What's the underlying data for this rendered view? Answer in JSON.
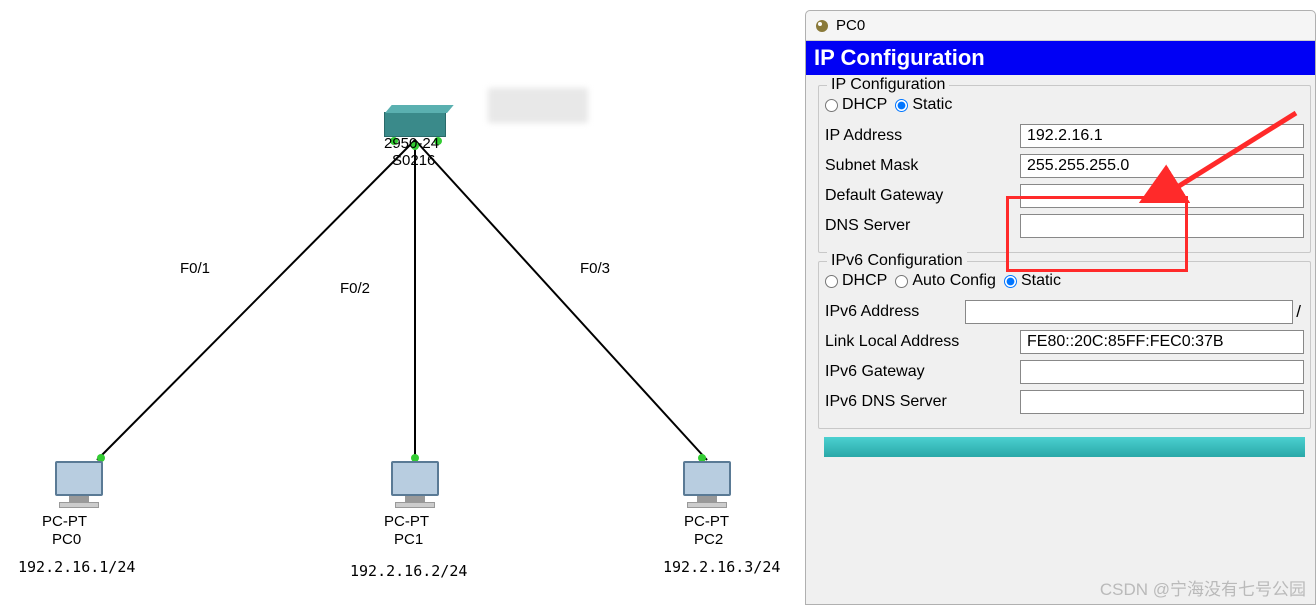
{
  "topology": {
    "switch": {
      "model": "2950-24",
      "name": "S0216"
    },
    "ports": {
      "p1": "F0/1",
      "p2": "F0/2",
      "p3": "F0/3"
    },
    "pc0": {
      "type": "PC-PT",
      "name": "PC0",
      "ip": "192.2.16.1/24"
    },
    "pc1": {
      "type": "PC-PT",
      "name": "PC1",
      "ip": "192.2.16.2/24"
    },
    "pc2": {
      "type": "PC-PT",
      "name": "PC2",
      "ip": "192.2.16.3/24"
    }
  },
  "window": {
    "title": "PC0"
  },
  "header": {
    "title": "IP Configuration"
  },
  "ipv4": {
    "group_title": "IP Configuration",
    "dhcp_label": "DHCP",
    "static_label": "Static",
    "mode": "static",
    "ip_label": "IP Address",
    "ip_value": "192.2.16.1",
    "mask_label": "Subnet Mask",
    "mask_value": "255.255.255.0",
    "gateway_label": "Default Gateway",
    "gateway_value": "",
    "dns_label": "DNS Server",
    "dns_value": ""
  },
  "ipv6": {
    "group_title": "IPv6 Configuration",
    "dhcp_label": "DHCP",
    "auto_label": "Auto Config",
    "static_label": "Static",
    "mode": "static",
    "addr_label": "IPv6 Address",
    "addr_value": "",
    "linklocal_label": "Link Local Address",
    "linklocal_value": "FE80::20C:85FF:FEC0:37B",
    "gateway_label": "IPv6 Gateway",
    "gateway_value": "",
    "dns_label": "IPv6 DNS Server",
    "dns_value": ""
  },
  "watermark": "CSDN @宁海没有七号公园"
}
